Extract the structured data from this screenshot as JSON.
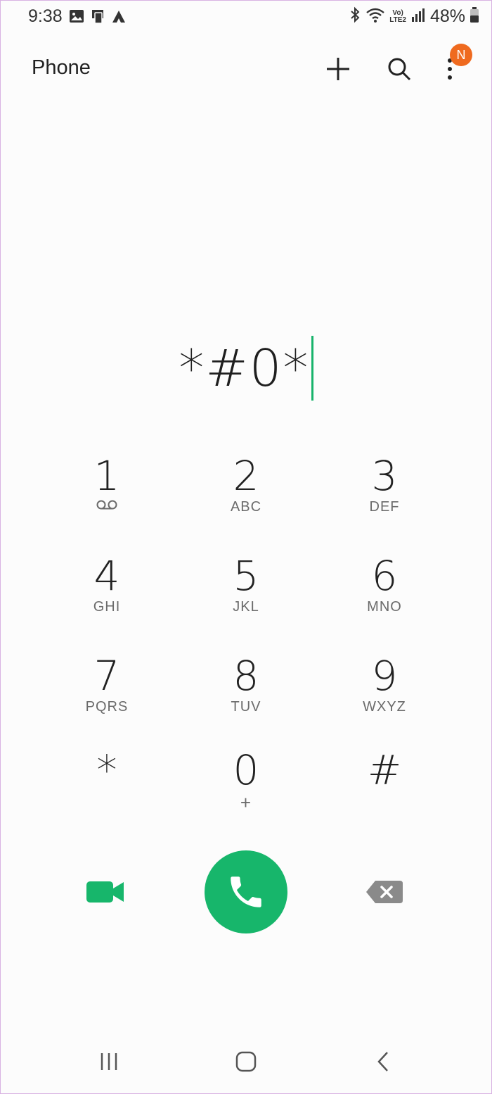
{
  "status_bar": {
    "time": "9:38",
    "battery_percent": "48%",
    "volte_label_top": "Vo)",
    "volte_label_bottom": "LTE2",
    "icons": [
      "gallery-icon",
      "cast-icon",
      "app-icon",
      "bluetooth-icon",
      "wifi-icon",
      "signal-icon",
      "battery-icon"
    ]
  },
  "app_bar": {
    "title": "Phone",
    "actions": [
      "add-icon",
      "search-icon",
      "more-icon"
    ],
    "notification_badge": "N"
  },
  "dialer": {
    "input_value": "*#0*",
    "keys": [
      {
        "digit": "1",
        "letters": ""
      },
      {
        "digit": "2",
        "letters": "ABC"
      },
      {
        "digit": "3",
        "letters": "DEF"
      },
      {
        "digit": "4",
        "letters": "GHI"
      },
      {
        "digit": "5",
        "letters": "JKL"
      },
      {
        "digit": "6",
        "letters": "MNO"
      },
      {
        "digit": "7",
        "letters": "PQRS"
      },
      {
        "digit": "8",
        "letters": "TUV"
      },
      {
        "digit": "9",
        "letters": "WXYZ"
      },
      {
        "digit": "*",
        "letters": ""
      },
      {
        "digit": "0",
        "letters": "+"
      },
      {
        "digit": "#",
        "letters": ""
      }
    ]
  },
  "colors": {
    "accent_green": "#17b66b",
    "badge_orange": "#ef6a1f",
    "backspace_gray": "#8a8a8a"
  }
}
